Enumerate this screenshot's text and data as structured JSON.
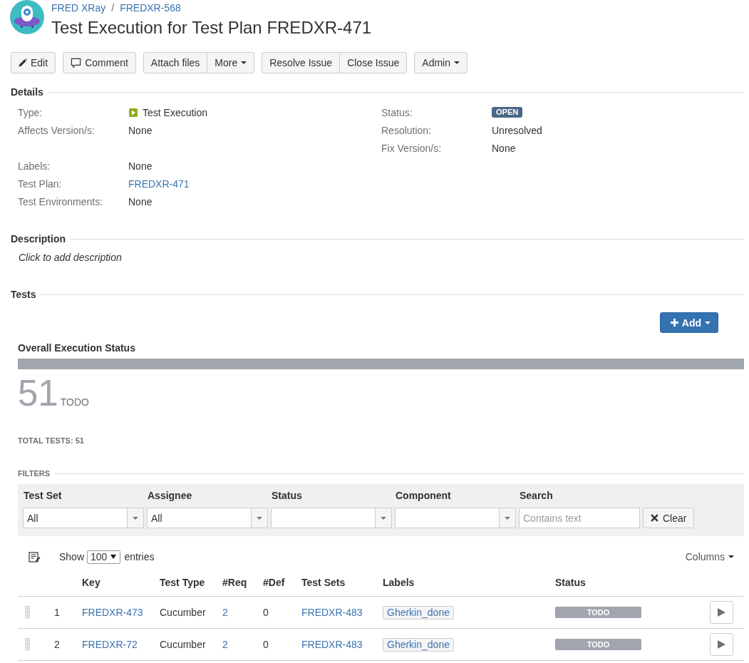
{
  "header": {
    "breadcrumbs": [
      "FRED XRay",
      "FREDXR-568"
    ],
    "separator": "/",
    "title": "Test Execution for Test Plan FREDXR-471"
  },
  "toolbar": {
    "groups": [
      [
        {
          "label": "Edit",
          "kind": "edit"
        }
      ],
      [
        {
          "label": "Comment",
          "kind": "comment"
        }
      ],
      [
        {
          "label": "Attach files",
          "kind": "plain"
        },
        {
          "label": "More",
          "kind": "dropdown"
        }
      ],
      [
        {
          "label": "Resolve Issue",
          "kind": "plain"
        },
        {
          "label": "Close Issue",
          "kind": "plain"
        }
      ],
      [
        {
          "label": "Admin",
          "kind": "dropdown"
        }
      ]
    ]
  },
  "details": {
    "title": "Details",
    "left": [
      {
        "label": "Type:",
        "value": "Test Execution",
        "kind": "type"
      },
      {
        "label": "Affects Version/s:",
        "value": "None",
        "kind": "text"
      }
    ],
    "right": [
      {
        "label": "Status:",
        "value": "OPEN",
        "kind": "status"
      },
      {
        "label": "Resolution:",
        "value": "Unresolved",
        "kind": "text"
      },
      {
        "label": "Fix Version/s:",
        "value": "None",
        "kind": "text"
      }
    ],
    "more": [
      {
        "label": "Labels:",
        "value": "None",
        "kind": "text"
      },
      {
        "label": "Test Plan:",
        "value": "FREDXR-471",
        "kind": "link"
      },
      {
        "label": "Test Environments:",
        "value": "None",
        "kind": "text"
      }
    ]
  },
  "description": {
    "title": "Description",
    "prompt": "Click to add description"
  },
  "tests": {
    "title": "Tests",
    "add_button": "Add",
    "overall": {
      "title": "Overall Execution Status",
      "segments": [
        {
          "kind": "todo",
          "level": 1
        }
      ],
      "count": "51",
      "count_label": "TODO",
      "total": "TOTAL TESTS: 51"
    },
    "filters": {
      "title": "FILTERS",
      "fields": [
        {
          "label": "Test Set",
          "kind": "select",
          "value": "All"
        },
        {
          "label": "Assignee",
          "kind": "select",
          "value": "All"
        },
        {
          "label": "Status",
          "kind": "select"
        },
        {
          "label": "Component",
          "kind": "select"
        },
        {
          "label": "Search",
          "kind": "search",
          "placeholder": "Contains text"
        }
      ],
      "clear_button": "Clear"
    },
    "table_controls": {
      "show": "Show",
      "page_size": "100",
      "entries": "entries",
      "columns_button": "Columns"
    },
    "table": {
      "columns": [
        "Key",
        "Test Type",
        "#Req",
        "#Def",
        "Test Sets",
        "Labels",
        "Status"
      ],
      "rows": [
        {
          "index": "1",
          "key": "FREDXR-473",
          "test_type": "Cucumber",
          "req": "2",
          "def": "0",
          "test_sets": "FREDXR-483",
          "labels": [
            "Gherkin_done"
          ],
          "status": "TODO"
        },
        {
          "index": "2",
          "key": "FREDXR-72",
          "test_type": "Cucumber",
          "req": "2",
          "def": "0",
          "test_sets": "FREDXR-483",
          "labels": [
            "Gherkin_done"
          ],
          "status": "TODO"
        }
      ]
    }
  }
}
